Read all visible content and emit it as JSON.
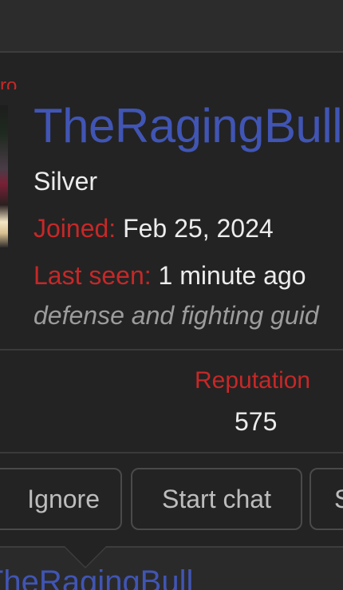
{
  "profile": {
    "username": "TheRagingBull",
    "rank": "Silver",
    "joined_label": "Joined:",
    "joined_value": "Feb 25, 2024",
    "seen_label": "Last seen:",
    "seen_value": "1 minute ago",
    "bio": "defense and fighting guid",
    "reputation_label": "Reputation",
    "reputation_value": "575",
    "fragment": "ro"
  },
  "actions": {
    "ignore": "Ignore",
    "start_chat": "Start chat",
    "more": "S"
  },
  "next_post": {
    "username": "TheRagingBull"
  },
  "colors": {
    "username": "#4055b4",
    "label": "#c62828",
    "text": "#ececec",
    "muted": "#9c9c9c"
  }
}
